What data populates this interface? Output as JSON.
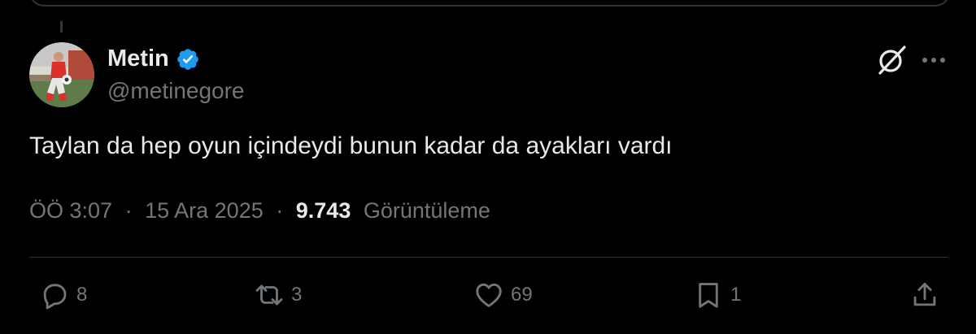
{
  "tweet": {
    "author": {
      "display_name": "Metin",
      "handle": "@metinegore",
      "verified": true
    },
    "text": "Taylan da hep oyun içindeydi bunun kadar da ayakları vardı",
    "time": "ÖÖ 3:07",
    "separator": "·",
    "date": "15 Ara 2025",
    "views_count": "9.743",
    "views_label": "Görüntüleme"
  },
  "actions": {
    "replies": "8",
    "reposts": "3",
    "likes": "69",
    "bookmarks": "1"
  },
  "colors": {
    "background": "#000000",
    "text_primary": "#e7e9ea",
    "text_secondary": "#71767b",
    "verified_blue": "#1d9bf0",
    "divider": "#2f3336"
  },
  "icons": {
    "verified": "verified-badge-icon",
    "grok": "grok-icon",
    "more": "more-horizontal-icon",
    "reply": "reply-icon",
    "repost": "repost-icon",
    "like": "heart-icon",
    "bookmark": "bookmark-icon",
    "share": "share-icon"
  }
}
